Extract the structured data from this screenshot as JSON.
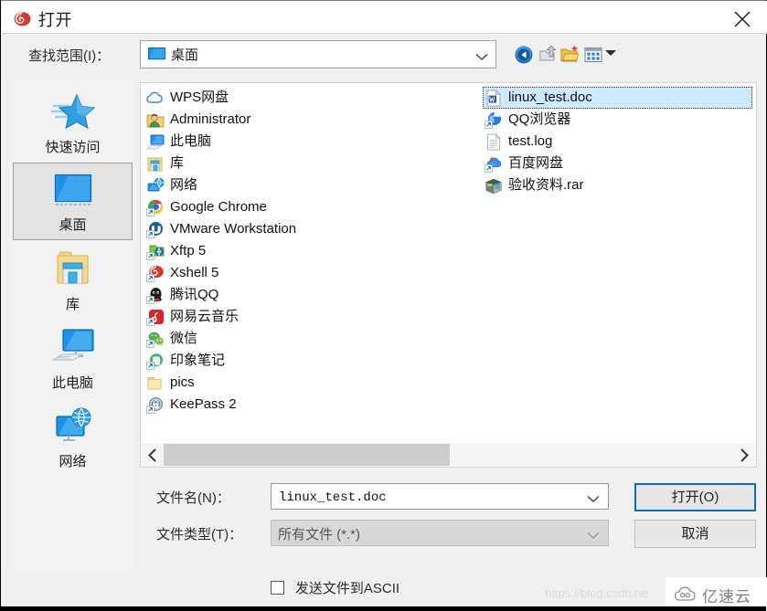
{
  "window": {
    "title": "打开",
    "title_icon": "xshell-logo-icon",
    "close_icon": "close-icon"
  },
  "lookin": {
    "label": "查找范围(I)：",
    "value": "桌面",
    "icon": "desktop-icon",
    "chevron": "chevron-down-icon"
  },
  "toolbar": {
    "back": "back-icon",
    "up": "up-folder-icon",
    "new_folder": "new-folder-icon",
    "views": "views-icon",
    "views_arrow": "chevron-down-icon"
  },
  "places": [
    {
      "label": "快速访问",
      "icon": "star-icon",
      "selected": false
    },
    {
      "label": "桌面",
      "icon": "desktop-icon",
      "selected": true
    },
    {
      "label": "库",
      "icon": "libraries-icon",
      "selected": false
    },
    {
      "label": "此电脑",
      "icon": "computer-icon",
      "selected": false
    },
    {
      "label": "网络",
      "icon": "network-icon",
      "selected": false
    }
  ],
  "file_list": {
    "column1": [
      {
        "name": "WPS网盘",
        "icon": "cloud-icon",
        "selected": false
      },
      {
        "name": "Administrator",
        "icon": "user-folder-icon",
        "selected": false
      },
      {
        "name": "此电脑",
        "icon": "computer-icon",
        "selected": false
      },
      {
        "name": "库",
        "icon": "libraries-icon",
        "selected": false
      },
      {
        "name": "网络",
        "icon": "network-icon",
        "selected": false
      },
      {
        "name": "Google Chrome",
        "icon": "chrome-shortcut-icon",
        "selected": false
      },
      {
        "name": "VMware Workstation",
        "icon": "vmware-shortcut-icon",
        "selected": false
      },
      {
        "name": "Xftp 5",
        "icon": "xftp-shortcut-icon",
        "selected": false
      },
      {
        "name": "Xshell 5",
        "icon": "xshell-shortcut-icon",
        "selected": false
      },
      {
        "name": "腾讯QQ",
        "icon": "qq-shortcut-icon",
        "selected": false
      },
      {
        "name": "网易云音乐",
        "icon": "netease-music-shortcut-icon",
        "selected": false
      },
      {
        "name": "微信",
        "icon": "wechat-shortcut-icon",
        "selected": false
      },
      {
        "name": "印象笔记",
        "icon": "evernote-shortcut-icon",
        "selected": false
      },
      {
        "name": "pics",
        "icon": "folder-icon",
        "selected": false
      },
      {
        "name": "KeePass 2",
        "icon": "keepass-shortcut-icon",
        "selected": false
      }
    ],
    "column2": [
      {
        "name": "linux_test.doc",
        "icon": "word-doc-icon",
        "selected": true
      },
      {
        "name": "QQ浏览器",
        "icon": "qq-browser-shortcut-icon",
        "selected": false
      },
      {
        "name": "test.log",
        "icon": "text-file-icon",
        "selected": false
      },
      {
        "name": "百度网盘",
        "icon": "baidu-netdisk-shortcut-icon",
        "selected": false
      },
      {
        "name": "验收资料.rar",
        "icon": "rar-archive-icon",
        "selected": false
      }
    ]
  },
  "scrollbar": {
    "left_arrow": "chevron-left-icon",
    "right_arrow": "chevron-right-icon"
  },
  "form": {
    "filename_label": "文件名(N)：",
    "filename_value": "linux_test.doc",
    "filetype_label": "文件类型(T)：",
    "filetype_value": "所有文件 (*.*)",
    "chevron": "chevron-down-icon"
  },
  "buttons": {
    "open": "打开(O)",
    "cancel": "取消",
    "focus_color": "#1567b8"
  },
  "ascii_option": {
    "label": "发送文件到ASCII",
    "checked": false
  },
  "watermark": {
    "url": "https://blog.csdn.ne",
    "badge_text": "亿速云",
    "badge_icon": "cloud-logo-icon"
  }
}
